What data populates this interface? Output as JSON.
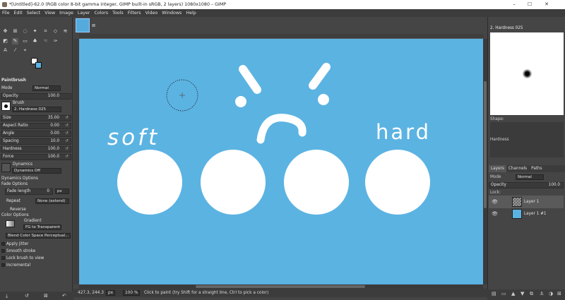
{
  "window": {
    "title": "*[Untitled]-62.0 (RGB color 8-bit gamma integer, GIMP built-in sRGB, 2 layers) 1080x1080 – GIMP",
    "min": "–",
    "max": "☐",
    "close": "✕"
  },
  "menu": [
    "File",
    "Edit",
    "Select",
    "View",
    "Image",
    "Layer",
    "Colors",
    "Tools",
    "Filters",
    "Video",
    "Windows",
    "Help"
  ],
  "tool_options": {
    "title": "Paintbrush",
    "mode_label": "Mode",
    "mode_value": "Normal",
    "opacity_label": "Opacity",
    "opacity_value": "100.0",
    "brush_label": "Brush",
    "brush_value": "2. Hardness 025",
    "size_label": "Size",
    "size_value": "35.00",
    "aspect_label": "Aspect Ratio",
    "aspect_value": "0.00",
    "angle_label": "Angle",
    "angle_value": "0.00",
    "spacing_label": "Spacing",
    "spacing_value": "10.0",
    "hardness_label": "Hardness",
    "hardness_value": "100.0",
    "force_label": "Force",
    "force_value": "100.0",
    "dynamics_label": "Dynamics",
    "dynamics_value": "Dynamics Off",
    "dynamics_options": "Dynamics Options",
    "fade_options": "Fade Options",
    "fade_length_label": "Fade length",
    "fade_length_value": "0",
    "fade_unit": "px",
    "repeat_label": "Repeat",
    "repeat_value": "None (extend)",
    "reverse": "Reverse",
    "color_options": "Color Options",
    "gradient_label": "Gradient",
    "gradient_value": "FG to Transparent",
    "blend_value": "Blend Color Space Perceptual...",
    "apply_jitter": "Apply Jitter",
    "smooth_stroke": "Smooth stroke",
    "lock_brush": "Lock brush to view",
    "incremental": "Incremental"
  },
  "canvas": {
    "background": "#5bb3e2",
    "text_soft": "soft",
    "text_hard": "hard"
  },
  "status": {
    "coords": "427.3, 244.3",
    "unit": "px",
    "zoom": "100 %",
    "message": "Click to paint (try Shift for a straight line, Ctrl to pick a color)"
  },
  "right_panel": {
    "brush_name": "2. Hardness 025",
    "shape_label": "Shape:",
    "hardness_label": "Hardness",
    "tabs": [
      "Layers",
      "Channels",
      "Paths"
    ],
    "mode_label": "Mode",
    "mode_value": "Normal",
    "opacity_label": "Opacity",
    "opacity_value": "100.0",
    "lock_label": "Lock:",
    "layers": [
      {
        "name": "Layer 1"
      },
      {
        "name": "Layer 1 #1"
      }
    ]
  },
  "colors": {
    "accent": "#5bb3e2",
    "panel": "#454545"
  }
}
